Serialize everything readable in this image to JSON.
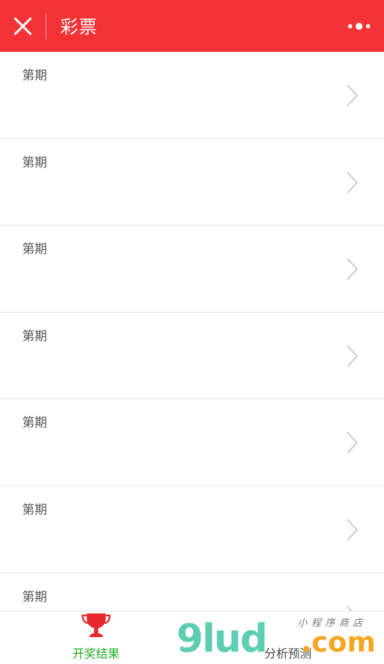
{
  "header": {
    "title": "彩票",
    "close_icon": "close-icon",
    "more_icon": "more-icon",
    "background": "#f23237"
  },
  "list": {
    "items": [
      {
        "label": "第期"
      },
      {
        "label": "第期"
      },
      {
        "label": "第期"
      },
      {
        "label": "第期"
      },
      {
        "label": "第期"
      },
      {
        "label": "第期"
      },
      {
        "label": "第期"
      }
    ],
    "chevron_icon": "chevron-right-icon"
  },
  "tabbar": {
    "tabs": [
      {
        "label": "开奖结果",
        "icon": "trophy-icon",
        "active": true,
        "color": "#1aad19"
      },
      {
        "label": "分析预测",
        "icon": "chart-icon",
        "active": false
      }
    ]
  },
  "watermark": {
    "main": "9lud",
    "com": ".com",
    "sub": "小程序商店"
  }
}
